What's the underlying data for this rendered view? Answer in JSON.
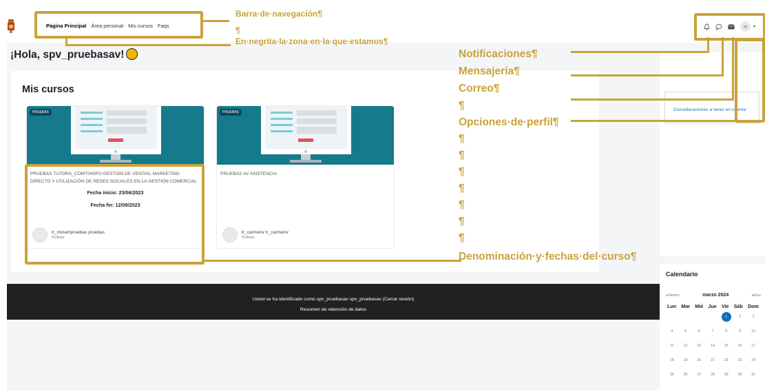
{
  "navbar": {
    "links": [
      {
        "label": "Página Principal",
        "active": true
      },
      {
        "label": "Área personal"
      },
      {
        "label": "Mis cursos"
      },
      {
        "label": "Faqs"
      }
    ],
    "user_initials": "sp",
    "icons": [
      "bell-icon",
      "chat-icon",
      "envelope-icon",
      "chevron-down-icon"
    ]
  },
  "main": {
    "greeting": "¡Hola, spv_pruebasav!",
    "courses_title": "Mis cursos",
    "courses": [
      {
        "tag": "PRUEBAS",
        "name": "PRUEBAS TUTORA_COMT040PO GESTIÓN DE VENTAS, MARKETING DIRECTO Y UTILIZACIÓN DE REDES SOCIALES EN LA GESTIÓN COMERCIAL",
        "start": "Fecha inicio: 23/06/2023",
        "end": "Fecha fin: 12/09/2023",
        "teacher": "tr_miriampruebas pruebas",
        "role": "Profesor"
      },
      {
        "tag": "PRUEBAS",
        "name": "PRUEBAS AV ASISTENCIA",
        "teacher": "tr_carmenv tr_carmenv",
        "role": "Profesor"
      }
    ]
  },
  "footer": {
    "login_info": "Usted se ha identificado como spv_pruebasav spv_pruebasav (Cerrar sesión)",
    "data_link": "Resumen de retención de datos"
  },
  "drawer": {
    "block_link": "Consideraciones a tener en cuenta",
    "calendar": {
      "title": "Calendario",
      "prev": "◂ febrero",
      "month": "marzo 2024",
      "next": "abril ▸",
      "weekdays": [
        "Lun",
        "Mar",
        "Mié",
        "Jue",
        "Vie",
        "Sáb",
        "Dom"
      ],
      "today": "1"
    }
  },
  "annotations": {
    "nav_label": "Barra·de·navegación¶",
    "pilcrow": "¶",
    "bold_note": "En·negrita·la·zona·en·la·que·estamos¶",
    "notifications": "Notificaciones¶",
    "messaging": "Mensajería¶",
    "mail": "Correo¶",
    "profile": "Opciones·de·perfil¶",
    "course_note": "Denominación·y·fechas·del·curso¶"
  },
  "colors": {
    "annotation": "#c9a23a",
    "course_header": "#167a8d",
    "footer": "#202222",
    "today": "#0f6cbf"
  }
}
